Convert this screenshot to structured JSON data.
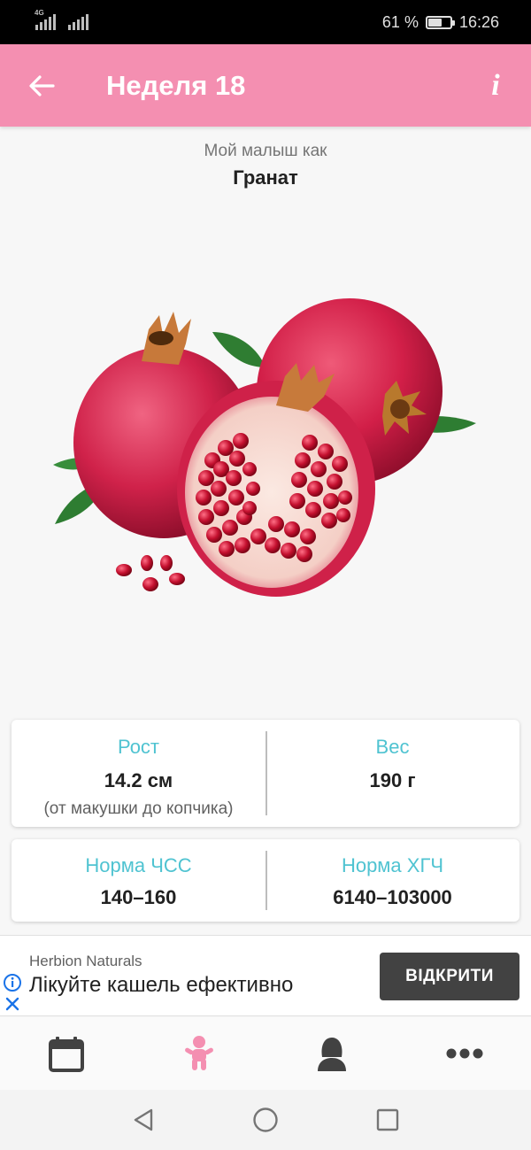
{
  "status_bar": {
    "network_label": "4G",
    "battery_text": "61 %",
    "battery_level": 0.61,
    "time": "16:26"
  },
  "app_bar": {
    "title": "Неделя 18",
    "back_icon": "arrow-left-icon",
    "info_icon": "info-icon",
    "info_label": "i",
    "color": "#f48fb1"
  },
  "baby_size": {
    "caption": "Мой малыш как",
    "fruit_name": "Гранат",
    "image": "pomegranate-image"
  },
  "stats": {
    "height": {
      "label": "Рост",
      "value": "14.2 см",
      "note": "(от макушки до копчика)"
    },
    "weight": {
      "label": "Вес",
      "value": "190 г"
    },
    "heart_rate": {
      "label": "Норма ЧСС",
      "value": "140–160"
    },
    "hcg": {
      "label": "Норма ХГЧ",
      "value": "6140–103000"
    },
    "label_color": "#4fc3d1"
  },
  "ad": {
    "advertiser": "Herbion Naturals",
    "headline": "Лікуйте кашель ефективно",
    "cta": "ВІДКРИТИ",
    "info_icon": "ad-info-icon",
    "close_icon": "ad-close-icon"
  },
  "bottom_nav": {
    "items": [
      {
        "icon": "calendar-icon",
        "active": false
      },
      {
        "icon": "baby-icon",
        "active": true
      },
      {
        "icon": "mother-icon",
        "active": false
      },
      {
        "icon": "more-icon",
        "active": false
      }
    ],
    "active_color": "#f48fb1",
    "inactive_color": "#424242"
  },
  "system_nav": {
    "items": [
      "back-triangle-icon",
      "home-circle-icon",
      "recents-square-icon"
    ]
  }
}
